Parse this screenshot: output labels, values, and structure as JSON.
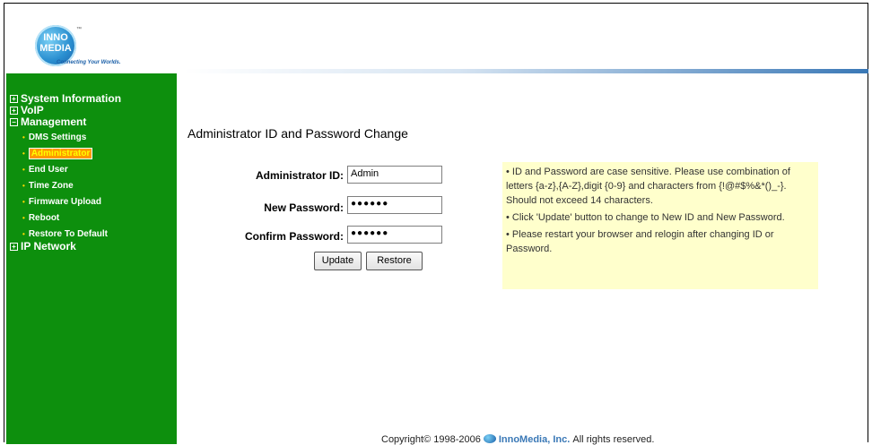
{
  "logo": {
    "line1": "INNO",
    "line2": "MEDIA",
    "tm": "™",
    "tagline": "Connecting Your Worlds."
  },
  "sidebar": {
    "system_information": "System Information",
    "voip": "VoIP",
    "management": "Management",
    "management_items": [
      "DMS Settings",
      "Administrator",
      "End User",
      "Time Zone",
      "Firmware Upload",
      "Reboot",
      "Restore To Default"
    ],
    "ip_network": "IP Network",
    "expand_symbol": "+",
    "collapse_symbol": "−"
  },
  "main": {
    "title": "Administrator ID and Password Change",
    "admin_id_label": "Administrator ID:",
    "admin_id_value": "Admin",
    "new_password_label": "New Password:",
    "new_password_value": "●●●●●●",
    "confirm_password_label": "Confirm Password:",
    "confirm_password_value": "●●●●●●",
    "update_label": "Update",
    "restore_label": "Restore"
  },
  "info": {
    "bullet1": "•  ID and Password are case sensitive. Please use combination of letters {a-z},{A-Z},digit {0-9} and characters from {!@#$%&*()_-}. Should not exceed 14 characters.",
    "bullet2": "•  Click 'Update' button to change to New ID and New Password.",
    "bullet3": "•  Please restart your browser and relogin after changing ID or Password."
  },
  "footer": {
    "copyright": "Copyright© 1998-2006",
    "brand": "InnoMedia, Inc.",
    "rights": "All rights reserved."
  },
  "colors": {
    "sidebar_bg": "#0d8f0d",
    "active_item_bg": "#ff9900",
    "info_bg": "#ffffcc"
  }
}
